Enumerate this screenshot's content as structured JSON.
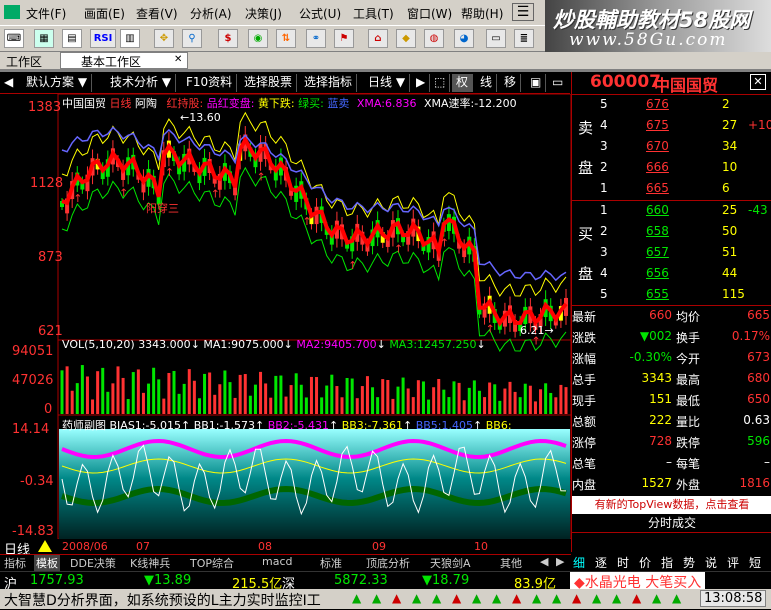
{
  "menu": [
    "文件(F)",
    "画面(E)",
    "查看(V)",
    "分析(A)",
    "决策(J)",
    "公式(U)",
    "工具(T)",
    "窗口(W)",
    "帮助(H)"
  ],
  "banner_text": "炒股輔助教材58股网",
  "banner_url": "www.58Gu.com",
  "toolbar": {
    "rsi_label": "RSI",
    "s_label": "$"
  },
  "workspace": {
    "label": "工作区",
    "tab": "基本工作区"
  },
  "fnbar": {
    "buttons": [
      "默认方案",
      "技术分析",
      "F10资料",
      "选择股票",
      "选择指标",
      "日线"
    ],
    "icons": [
      "权",
      "线",
      "移"
    ]
  },
  "main_legend": {
    "name": "中国国贸",
    "period": "日线",
    "mode": "阿陶",
    "t1": "红持股:",
    "t2": "品红变盘:",
    "t3": "黄下跌:",
    "t4": "绿买:",
    "t5": "蓝卖",
    "xma_label": "XMA:",
    "xma_val": "6.836",
    "xma_rate_label": "XMA速率:",
    "xma_rate_val": "-12.200"
  },
  "price_axis": [
    "1383",
    "1128",
    "873",
    "621"
  ],
  "annotations": {
    "high": "13.60",
    "low": "6.21",
    "pattern": "阳穿三"
  },
  "vol_legend": {
    "label": "VOL(5,10,20)",
    "v": "3343.000",
    "ma1_label": "MA1:",
    "ma1": "9075.000",
    "ma2_label": "MA2:",
    "ma2": "9405.700",
    "ma3_label": "MA3:",
    "ma3": "12457.250"
  },
  "vol_axis": [
    "94051",
    "47026",
    "0"
  ],
  "bias_legend": {
    "label": "药师副图",
    "b1_label": "BIAS1:",
    "b1": "-5.015",
    "bb1_label": "BB1:",
    "bb1": "-1.573",
    "bb2_label": "BB2:",
    "bb2": "-5.431",
    "bb3_label": "BB3:",
    "bb3": "-7.361",
    "bb5_label": "BB5:",
    "bb5": "1.405",
    "bb6_label": "BB6:",
    "bb6": ""
  },
  "bias_axis": [
    "14.14",
    "-0.34",
    "-14.83"
  ],
  "date_axis": {
    "label": "日线",
    "d1": "2008/06",
    "d2": "07",
    "d3": "08",
    "d4": "09",
    "d5": "10"
  },
  "bottom_tabs": [
    "指标",
    "模板",
    "DDE决策",
    "K线神兵",
    "TOP综合",
    "macd",
    "标准",
    "顶底分析",
    "天狼剑A",
    "其他"
  ],
  "right_panel": {
    "code": "600007",
    "name": "中国国贸",
    "sell_label": [
      "卖",
      "盘"
    ],
    "buy_label": [
      "买",
      "盘"
    ],
    "sell": [
      {
        "n": "5",
        "p": "676",
        "v": "2"
      },
      {
        "n": "4",
        "p": "675",
        "v": "27",
        "d": "+10"
      },
      {
        "n": "3",
        "p": "670",
        "v": "34"
      },
      {
        "n": "2",
        "p": "666",
        "v": "10"
      },
      {
        "n": "1",
        "p": "665",
        "v": "6"
      }
    ],
    "buy": [
      {
        "n": "1",
        "p": "660",
        "v": "25",
        "d": "-43"
      },
      {
        "n": "2",
        "p": "658",
        "v": "50"
      },
      {
        "n": "3",
        "p": "657",
        "v": "51"
      },
      {
        "n": "4",
        "p": "656",
        "v": "44"
      },
      {
        "n": "5",
        "p": "655",
        "v": "115"
      }
    ],
    "stats": [
      {
        "l": "最新",
        "v": "660",
        "l2": "均价",
        "v2": "665"
      },
      {
        "l": "涨跌",
        "v": "▼002",
        "l2": "换手",
        "v2": "0.17%"
      },
      {
        "l": "涨幅",
        "v": "-0.30%",
        "l2": "今开",
        "v2": "673"
      },
      {
        "l": "总手",
        "v": "3343",
        "l2": "最高",
        "v2": "680"
      },
      {
        "l": "现手",
        "v": "151",
        "l2": "最低",
        "v2": "650"
      },
      {
        "l": "总额",
        "v": "222",
        "l2": "量比",
        "v2": "0.63"
      },
      {
        "l": "涨停",
        "v": "728",
        "l2": "跌停",
        "v2": "596"
      },
      {
        "l": "总笔",
        "v": "–",
        "l2": "每笔",
        "v2": "–"
      },
      {
        "l": "内盘",
        "v": "1527",
        "l2": "外盘",
        "v2": "1816"
      }
    ],
    "topview": "有新的TopView数据，点击查看",
    "timesales": "分时成交",
    "rtabs": [
      "细",
      "逐",
      "时",
      "价",
      "指",
      "势",
      "说",
      "评",
      "短"
    ]
  },
  "status": {
    "sh_label": "沪",
    "sh_val": "1757.93",
    "sh_chg": "▼13.89",
    "sh_amt": "215.5亿",
    "sz_label": "深",
    "sz_val": "5872.33",
    "sz_chg": "▼18.79",
    "sz_amt": "83.9亿",
    "alert": "◆水晶光电 大笔买入"
  },
  "ticker": {
    "text": "大智慧D分析界面，如系统预设的L主力实时监控I工",
    "time": "13:08:58"
  },
  "colors": {
    "up": "#ff3232",
    "down": "#00e600",
    "accent": "#ffff00"
  }
}
